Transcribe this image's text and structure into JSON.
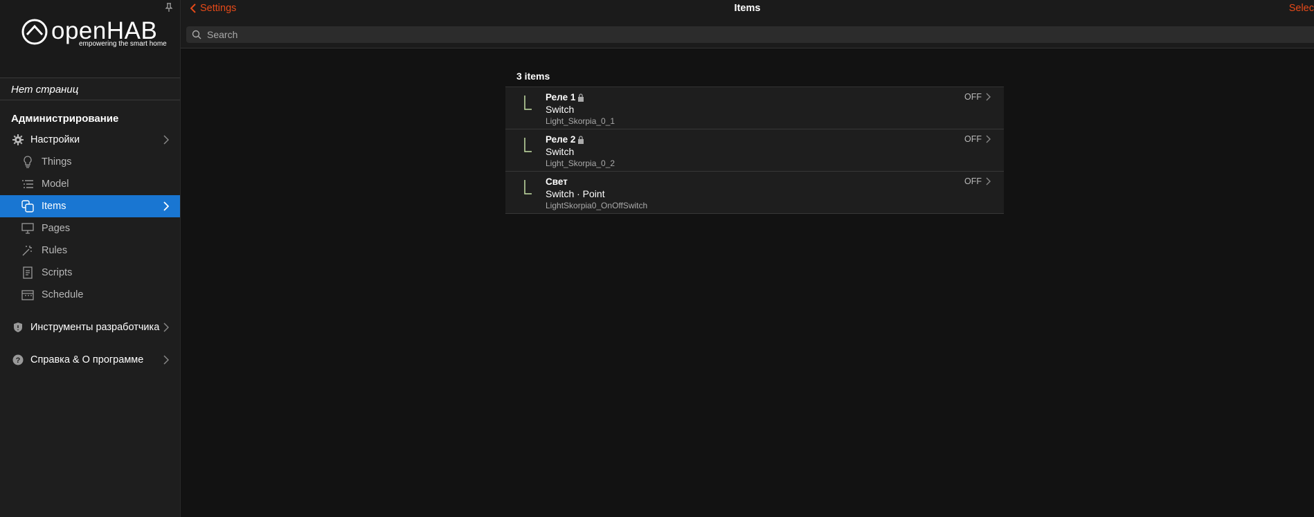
{
  "sidebar": {
    "logo": {
      "name": "openHAB",
      "tagline": "empowering the smart home"
    },
    "no_pages": "Нет страниц",
    "section": "Администрирование",
    "settings": {
      "label": "Настройки"
    },
    "sub_items": [
      {
        "label": "Things",
        "icon": "lightbulb-icon"
      },
      {
        "label": "Model",
        "icon": "list-tree-icon"
      },
      {
        "label": "Items",
        "icon": "items-squares-icon",
        "active": true
      },
      {
        "label": "Pages",
        "icon": "monitor-icon"
      },
      {
        "label": "Rules",
        "icon": "wand-icon"
      },
      {
        "label": "Scripts",
        "icon": "document-icon"
      },
      {
        "label": "Schedule",
        "icon": "calendar-icon"
      }
    ],
    "dev_tools": {
      "label": "Инструменты разработчика"
    },
    "help": {
      "label": "Справка & О программе"
    }
  },
  "topbar": {
    "back_label": "Settings",
    "title": "Items",
    "select_label": "Selec",
    "search_placeholder": "Search"
  },
  "list": {
    "count_label": "3 items",
    "items": [
      {
        "name": "Реле 1",
        "locked": true,
        "type": "Switch",
        "id": "Light_Skorpia_0_1",
        "state": "OFF"
      },
      {
        "name": "Реле 2",
        "locked": true,
        "type": "Switch",
        "id": "Light_Skorpia_0_2",
        "state": "OFF"
      },
      {
        "name": "Свет",
        "locked": false,
        "type": "Switch · Point",
        "id": "LightSkorpia0_OnOffSwitch",
        "state": "OFF"
      }
    ]
  },
  "colors": {
    "accent": "#e64a19",
    "active": "#1976d2",
    "glyph": "#c5e1a5"
  }
}
